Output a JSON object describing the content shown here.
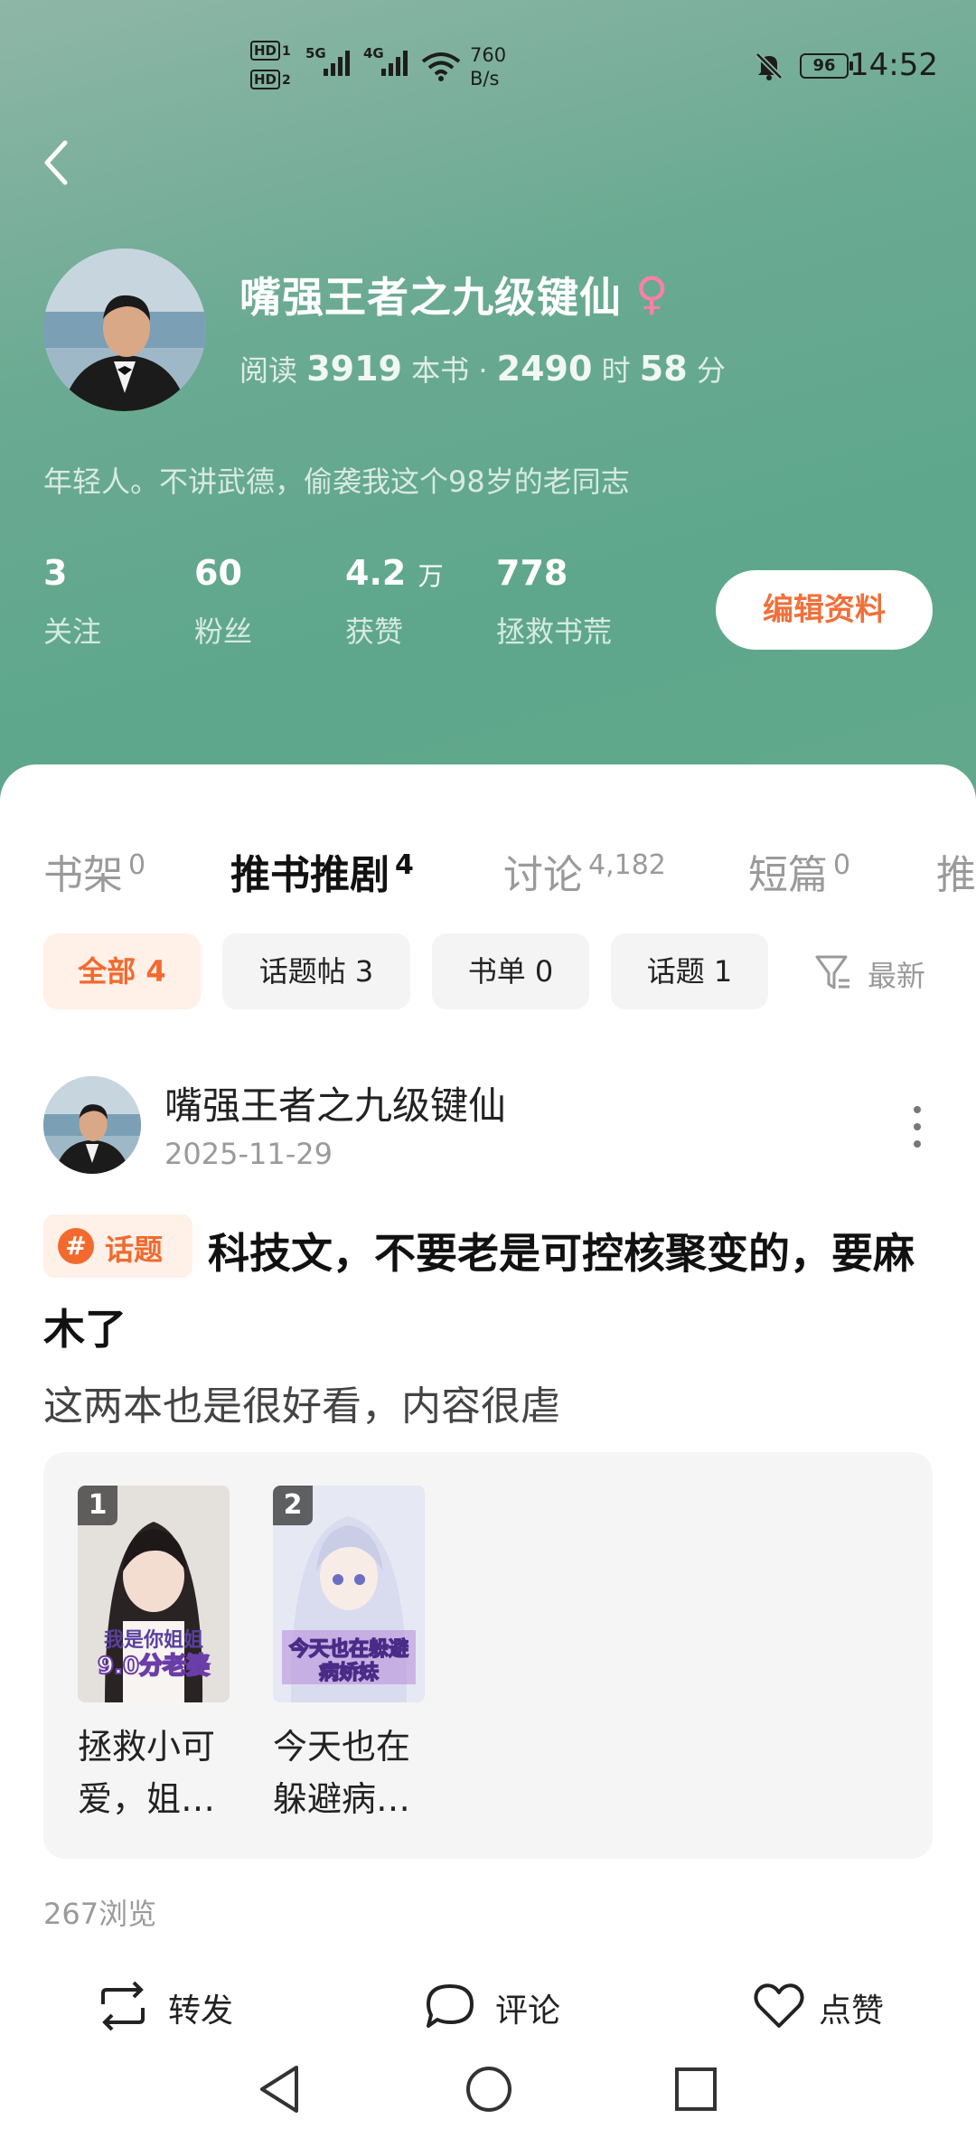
{
  "status_bar": {
    "hd1": "HD",
    "hd1_sub": "1",
    "hd2": "HD",
    "hd2_sub": "2",
    "sig1_label": "5G",
    "sig2_label": "4G",
    "net_speed_value": "760",
    "net_speed_unit": "B/s",
    "battery": "96",
    "time": "14:52",
    "icons": [
      "signal-icon",
      "wifi-icon",
      "mute-bell-icon",
      "battery-icon"
    ]
  },
  "profile": {
    "name": "嘴强王者之九级键仙",
    "gender_symbol": "♀",
    "read_prefix": "阅读",
    "books_count": "3919",
    "books_unit": "本书",
    "separator": "·",
    "hours": "2490",
    "hours_unit": "时",
    "minutes": "58",
    "minutes_unit": "分",
    "bio": "年轻人。不讲武德，偷袭我这个98岁的老同志"
  },
  "stats": [
    {
      "value": "3",
      "unit": "",
      "label": "关注"
    },
    {
      "value": "60",
      "unit": "",
      "label": "粉丝"
    },
    {
      "value": "4.2",
      "unit": "万",
      "label": "获赞"
    },
    {
      "value": "778",
      "unit": "",
      "label": "拯救书荒"
    }
  ],
  "edit_button": "编辑资料",
  "tabs": [
    {
      "label": "书架",
      "count": "0"
    },
    {
      "label": "推书推剧",
      "count": "4"
    },
    {
      "label": "讨论",
      "count": "4,182"
    },
    {
      "label": "短篇",
      "count": "0"
    },
    {
      "label": "推",
      "count": ""
    }
  ],
  "filters": [
    {
      "label": "全部 4"
    },
    {
      "label": "话题帖 3"
    },
    {
      "label": "书单 0"
    },
    {
      "label": "话题 1"
    }
  ],
  "sort_label": "最新",
  "post": {
    "author": "嘴强王者之九级键仙",
    "date": "2025-11-29",
    "topic_hash": "#",
    "topic_badge": "话题",
    "title": "科技文，不要老是可控核聚变的，要麻木了",
    "body": "这两本也是很好看，内容很虐",
    "books": [
      {
        "rank": "1",
        "title": "拯救小可爱，姐…",
        "cover_text": "我是你姐姐9.0分老婆"
      },
      {
        "rank": "2",
        "title": "今天也在躲避病…",
        "cover_text": "今天也在躲避病娇妹"
      }
    ],
    "views": "267浏览"
  },
  "actions": [
    {
      "label": "转发",
      "icon": "repost-icon"
    },
    {
      "label": "评论",
      "icon": "comment-icon"
    },
    {
      "label": "点赞",
      "icon": "heart-icon"
    }
  ],
  "colors": {
    "header_green": "#62a88d",
    "accent_orange": "#f26a2e",
    "gender_pink": "#ff7fa6"
  }
}
